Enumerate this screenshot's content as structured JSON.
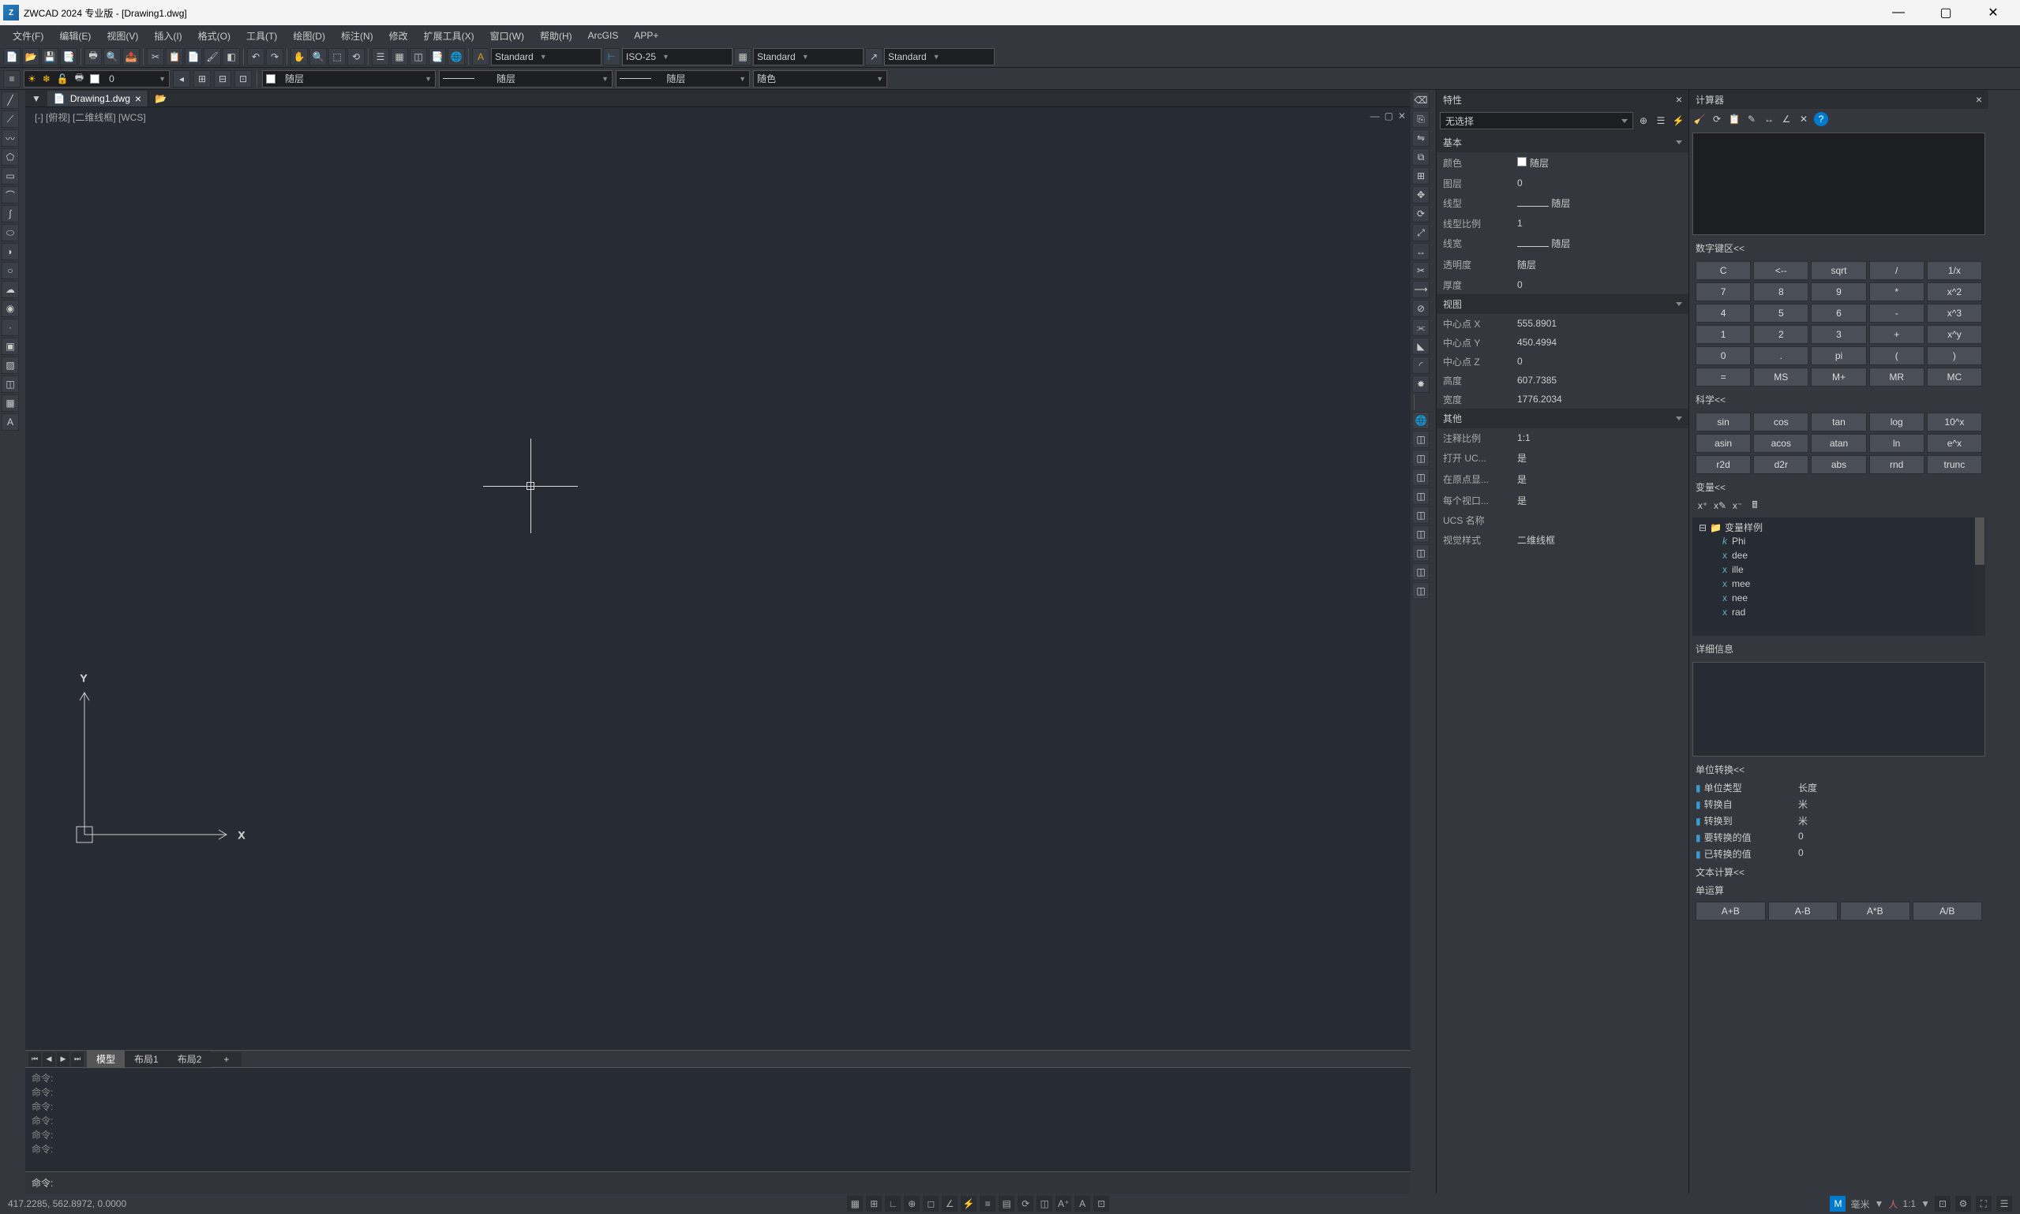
{
  "title": "ZWCAD 2024 专业版 - [Drawing1.dwg]",
  "menus": [
    "文件(F)",
    "编辑(E)",
    "视图(V)",
    "插入(I)",
    "格式(O)",
    "工具(T)",
    "绘图(D)",
    "标注(N)",
    "修改",
    "扩展工具(X)",
    "窗口(W)",
    "帮助(H)",
    "ArcGIS",
    "APP+"
  ],
  "styles": {
    "text": "Standard",
    "dim": "ISO-25",
    "table": "Standard",
    "mleader": "Standard"
  },
  "layer": {
    "name": "0"
  },
  "linetype": "随层",
  "lineweight": "随层",
  "color": "随色",
  "doc_tab": "Drawing1.dwg",
  "viewlabel": "[-] [俯视] [二维线框] [WCS]",
  "bottom_tabs": {
    "model": "模型",
    "layout1": "布局1",
    "layout2": "布局2",
    "add": "+"
  },
  "cmd_history": [
    "命令:",
    "命令:",
    "命令:",
    "命令:",
    "命令:",
    "命令:"
  ],
  "cmd_prompt": "命令:",
  "coords": "417.2285, 562.8972, 0.0000",
  "status_right": {
    "mm": "毫米",
    "scale": "1:1"
  },
  "props": {
    "title": "特性",
    "selection": "无选择",
    "sections": {
      "basic": {
        "header": "基本",
        "rows": [
          {
            "label": "颜色",
            "value": "随层",
            "swatch": true
          },
          {
            "label": "图层",
            "value": "0"
          },
          {
            "label": "线型",
            "value": "随层",
            "line": true
          },
          {
            "label": "线型比例",
            "value": "1"
          },
          {
            "label": "线宽",
            "value": "随层",
            "line": true
          },
          {
            "label": "透明度",
            "value": "随层"
          },
          {
            "label": "厚度",
            "value": "0"
          }
        ]
      },
      "view": {
        "header": "视图",
        "rows": [
          {
            "label": "中心点 X",
            "value": "555.8901"
          },
          {
            "label": "中心点 Y",
            "value": "450.4994"
          },
          {
            "label": "中心点 Z",
            "value": "0"
          },
          {
            "label": "高度",
            "value": "607.7385"
          },
          {
            "label": "宽度",
            "value": "1776.2034"
          }
        ]
      },
      "misc": {
        "header": "其他",
        "rows": [
          {
            "label": "注释比例",
            "value": "1:1"
          },
          {
            "label": "打开 UC...",
            "value": "是"
          },
          {
            "label": "在原点显...",
            "value": "是"
          },
          {
            "label": "每个视口...",
            "value": "是"
          },
          {
            "label": "UCS 名称",
            "value": ""
          },
          {
            "label": "视觉样式",
            "value": "二维线框"
          }
        ]
      }
    }
  },
  "calc": {
    "title": "计算器",
    "num_header": "数字键区<<",
    "sci_header": "科学<<",
    "var_header": "变量<<",
    "detail_header": "详细信息",
    "unit_header": "单位转换<<",
    "text_header": "文本计算<<",
    "single_op": "单运算",
    "num_keys": [
      "C",
      "<--",
      "sqrt",
      "/",
      "1/x",
      "7",
      "8",
      "9",
      "*",
      "x^2",
      "4",
      "5",
      "6",
      "-",
      "x^3",
      "1",
      "2",
      "3",
      "+",
      "x^y",
      "0",
      ".",
      "pi",
      "(",
      ")",
      "=",
      "MS",
      "M+",
      "MR",
      "MC"
    ],
    "sci_keys": [
      "sin",
      "cos",
      "tan",
      "log",
      "10^x",
      "asin",
      "acos",
      "atan",
      "ln",
      "e^x",
      "r2d",
      "d2r",
      "abs",
      "rnd",
      "trunc"
    ],
    "var_root": "变量样例",
    "vars": [
      {
        "sym": "k",
        "name": "Phi"
      },
      {
        "sym": "x",
        "name": "dee"
      },
      {
        "sym": "x",
        "name": "ille"
      },
      {
        "sym": "x",
        "name": "mee"
      },
      {
        "sym": "x",
        "name": "nee"
      },
      {
        "sym": "x",
        "name": "rad"
      }
    ],
    "units": [
      {
        "label": "单位类型",
        "value": "长度"
      },
      {
        "label": "转换自",
        "value": "米"
      },
      {
        "label": "转换到",
        "value": "米"
      },
      {
        "label": "要转换的值",
        "value": "0"
      },
      {
        "label": "已转换的值",
        "value": "0"
      }
    ],
    "footer_keys": [
      "A+B",
      "A-B",
      "A*B",
      "A/B"
    ]
  }
}
